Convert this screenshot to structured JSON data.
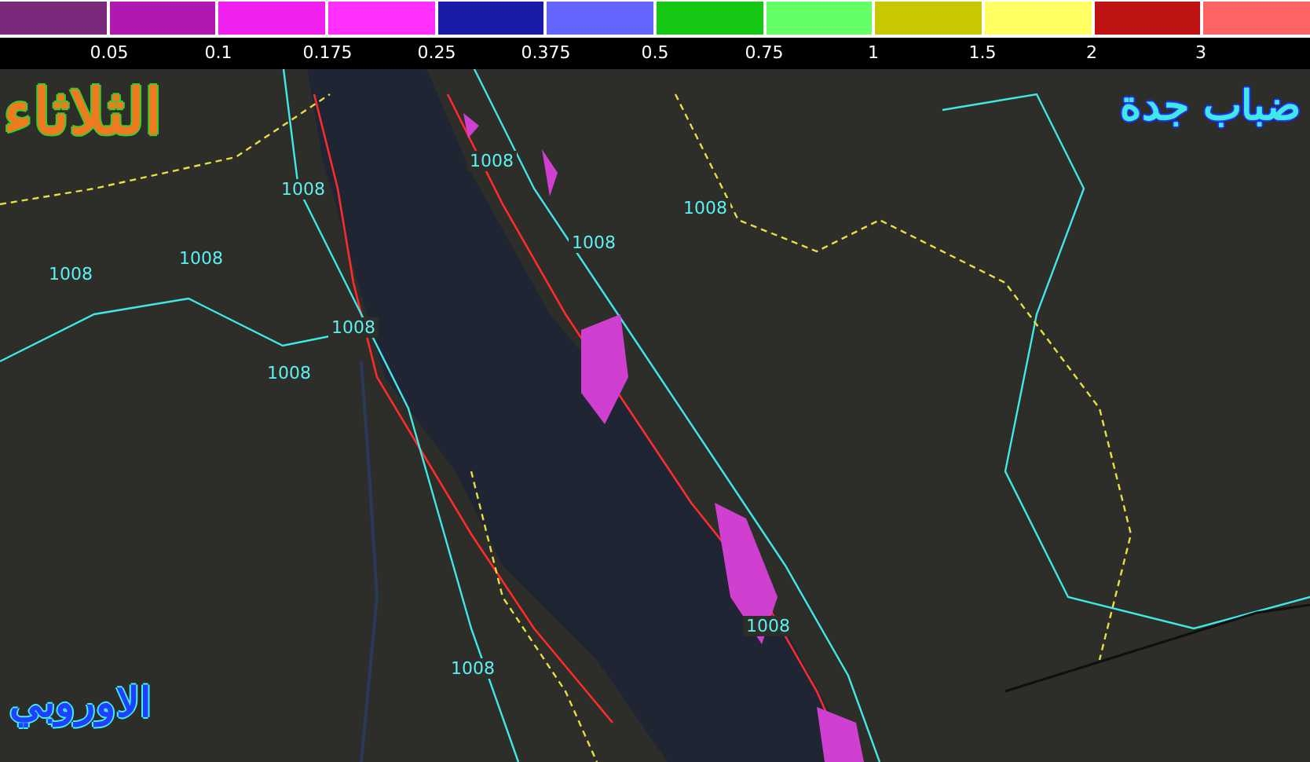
{
  "legend": {
    "swatches": [
      {
        "color": "#7a2a7a"
      },
      {
        "color": "#b018b0"
      },
      {
        "color": "#f020f0"
      },
      {
        "color": "#ff30ff"
      },
      {
        "color": "#1a1aa8"
      },
      {
        "color": "#6464ff"
      },
      {
        "color": "#14c814"
      },
      {
        "color": "#64ff64"
      },
      {
        "color": "#c8c800"
      },
      {
        "color": "#ffff64"
      },
      {
        "color": "#c01414"
      },
      {
        "color": "#ff6464"
      }
    ],
    "labels": [
      "0.05",
      "0.1",
      "0.175",
      "0.25",
      "0.375",
      "0.5",
      "0.75",
      "1",
      "1.5",
      "2",
      "3"
    ]
  },
  "day_label": "الثلاثاء",
  "title": "ضباب جدة",
  "model_label": "الاوروبي",
  "isobar_labels": [
    "1008",
    "1008",
    "1008",
    "1008",
    "1008",
    "1008",
    "1008",
    "1008",
    "1008",
    "1008"
  ]
}
